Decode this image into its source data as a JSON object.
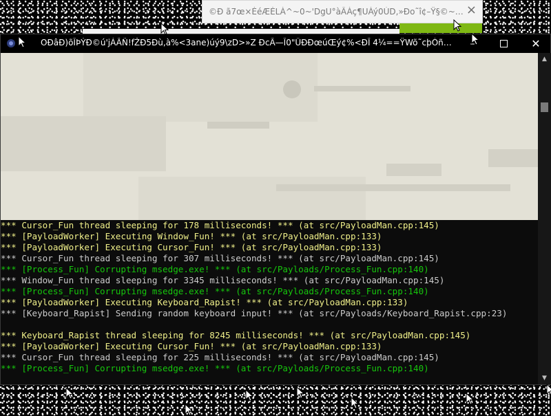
{
  "background_window": {
    "title": "©Ð ã7œ×ÉéÆÈLÀ^~0~'DgU°àÂÀç¶UÀý0ÙD,»Ðo˜î¢–Ÿ§©~'òµºhõ fø...",
    "close_icon": "close-icon"
  },
  "console": {
    "title": "OÐâÐ)õÎÞÝÐ©ú'jÁÂÑ!fŽÐ5Ðù,à%<3ane)úý9\\zD>»Z ÐcÃ—Î0\"ÛÐÐœúŒý¢%<ÐÎ 4¼==ŸWõ˜cþÓñlÎuÐeÂ{q˜ùúÑ°...",
    "icon": "console-app-icon",
    "buttons": {
      "minimize": "–",
      "maximize": "",
      "close": "✕"
    },
    "log_lines": [
      {
        "text": "*** Cursor_Fun thread sleeping for 178 milliseconds! *** (at src/PayloadMan.cpp:145)",
        "color": "yellow"
      },
      {
        "text": "*** [PayloadWorker] Executing Window_Fun! *** (at src/PayloadMan.cpp:133)",
        "color": "yellow"
      },
      {
        "text": "*** [PayloadWorker] Executing Cursor_Fun! *** (at src/PayloadMan.cpp:133)",
        "color": "yellow"
      },
      {
        "text": "*** Cursor_Fun thread sleeping for 307 milliseconds! *** (at src/PayloadMan.cpp:145)",
        "color": "white"
      },
      {
        "text": "*** [Process_Fun] Corrupting msedge.exe! *** (at src/Payloads/Process_Fun.cpp:140)",
        "color": "green"
      },
      {
        "text": "*** Window_Fun thread sleeping for 3345 milliseconds! *** (at src/PayloadMan.cpp:145)",
        "color": "white"
      },
      {
        "text": "*** [Process_Fun] Corrupting msedge.exe! *** (at src/Payloads/Process_Fun.cpp:140)",
        "color": "green"
      },
      {
        "text": "*** [PayloadWorker] Executing Keyboard_Rapist! *** (at src/PayloadMan.cpp:133)",
        "color": "yellow"
      },
      {
        "text": "*** [Keyboard_Rapist] Sending random keyboard input! *** (at src/Payloads/Keyboard_Rapist.cpp:23)",
        "color": "white"
      },
      {
        "text": "",
        "color": "white"
      },
      {
        "text": "*** Keyboard_Rapist thread sleeping for 8245 milliseconds! *** (at src/PayloadMan.cpp:145)",
        "color": "yellow"
      },
      {
        "text": "*** [PayloadWorker] Executing Cursor_Fun! *** (at src/PayloadMan.cpp:133)",
        "color": "yellow"
      },
      {
        "text": "*** Cursor_Fun thread sleeping for 225 milliseconds! *** (at src/PayloadMan.cpp:145)",
        "color": "white"
      },
      {
        "text": "*** [Process_Fun] Corrupting msedge.exe! *** (at src/Payloads/Process_Fun.cpp:140)",
        "color": "green"
      }
    ]
  },
  "colors": {
    "yellow": "#f0f08a",
    "green": "#16c60c",
    "white": "#cccccc"
  }
}
